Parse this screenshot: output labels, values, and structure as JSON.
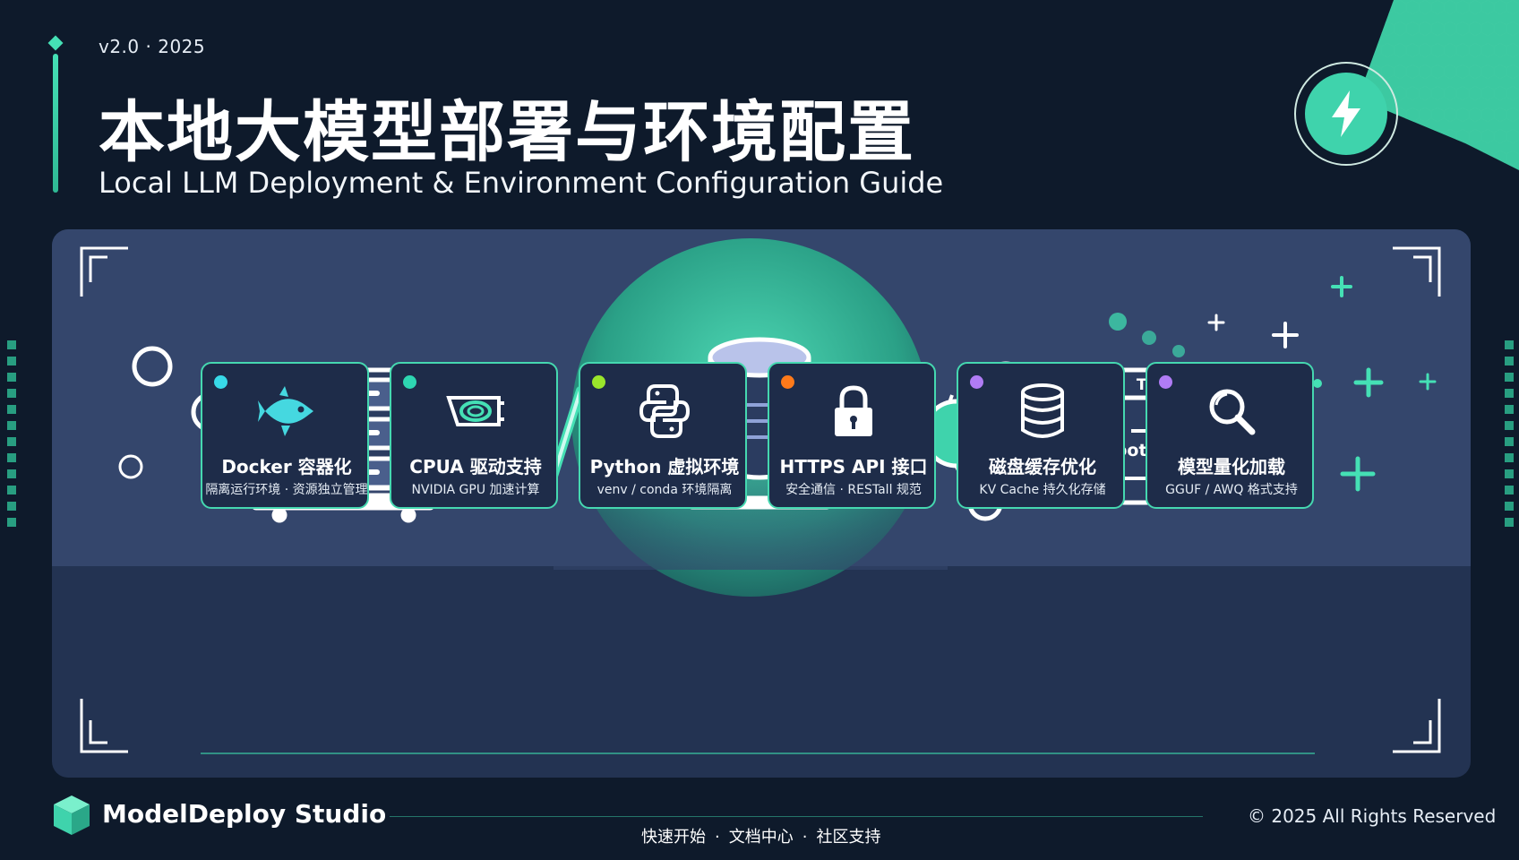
{
  "header": {
    "version": "v2.0 · 2025",
    "title_zh": "本地大模型部署与环境配置",
    "title_en": "Local LLM Deployment & Environment Configuration Guide"
  },
  "badge": {
    "icon": "lightning-icon",
    "color": "#3fd3ac"
  },
  "diagram": {
    "terminal": {
      "title": "Terminal",
      "prompt": "$",
      "host": "root@localhost:"
    }
  },
  "cards": [
    {
      "icon": "fish-icon",
      "dot_color": "#38d9e8",
      "title": "Docker 容器化",
      "subtitle": "隔离运行环境 · 资源独立管理"
    },
    {
      "icon": "gpu-chip-icon",
      "dot_color": "#2ed6b2",
      "title": "CPUA 驱动支持",
      "subtitle": "NVIDIA GPU 加速计算"
    },
    {
      "icon": "python-icon",
      "dot_color": "#9ae62b",
      "title": "Python 虚拟环境",
      "subtitle": "venv / conda 环境隔离"
    },
    {
      "icon": "lock-icon",
      "dot_color": "#ff7a1a",
      "title": "HTTPS API 接口",
      "subtitle": "安全通信 · RESTall 规范"
    },
    {
      "icon": "database-icon",
      "dot_color": "#b07cf5",
      "title": "磁盘缓存优化",
      "subtitle": "KV Cache 持久化存储"
    },
    {
      "icon": "magnifier-icon",
      "dot_color": "#b07cf5",
      "title": "模型量化加载",
      "subtitle": "GGUF / AWQ 格式支持"
    }
  ],
  "footer": {
    "brand": "ModelDeploy Studio",
    "links": [
      "快速开始",
      "文档中心",
      "社区支持"
    ],
    "copyright": "© 2025 All Rights Reserved"
  },
  "colors": {
    "accent": "#45e0b5",
    "background": "#0e1a2b",
    "panel": "#34466c"
  }
}
